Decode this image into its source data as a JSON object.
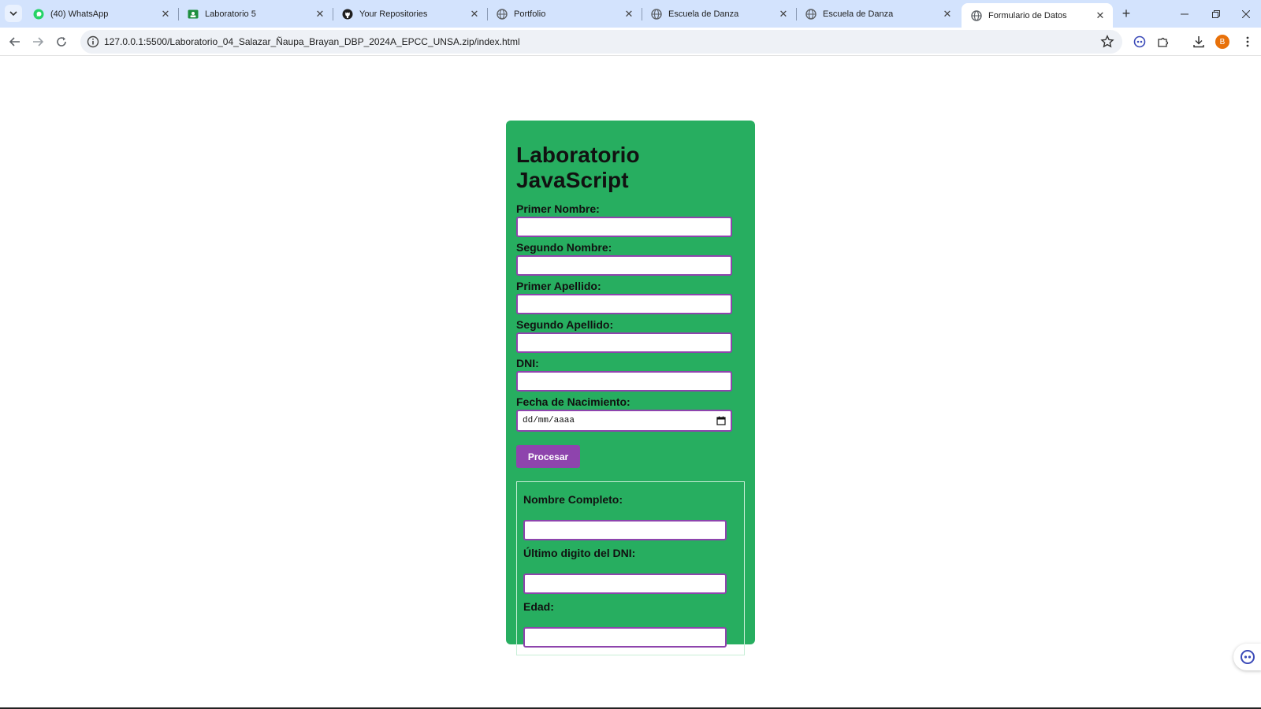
{
  "browser": {
    "tabs": [
      {
        "title": "(40) WhatsApp",
        "icon": "whatsapp-icon",
        "active": false
      },
      {
        "title": "Laboratorio 5",
        "icon": "classroom-icon",
        "active": false
      },
      {
        "title": "Your Repositories",
        "icon": "github-icon",
        "active": false
      },
      {
        "title": "Portfolio",
        "icon": "globe-icon",
        "active": false
      },
      {
        "title": "Escuela de Danza",
        "icon": "globe-icon",
        "active": false
      },
      {
        "title": "Escuela de Danza",
        "icon": "globe-icon",
        "active": false
      },
      {
        "title": "Formulario de Datos",
        "icon": "globe-icon",
        "active": true
      }
    ],
    "address": "127.0.0.1:5500/Laboratorio_04_Salazar_Ñaupa_Brayan_DBP_2024A_EPCC_UNSA.zip/index.html",
    "profile_initial": "B",
    "colors": {
      "tabstrip": "#d3e3fd",
      "profile": "#e8710a"
    }
  },
  "form": {
    "title": "Laboratorio JavaScript",
    "fields": [
      {
        "label": "Primer Nombre:",
        "value": ""
      },
      {
        "label": "Segundo Nombre:",
        "value": ""
      },
      {
        "label": "Primer Apellido:",
        "value": ""
      },
      {
        "label": "Segundo Apellido:",
        "value": ""
      },
      {
        "label": "DNI:",
        "value": ""
      }
    ],
    "birthdate": {
      "label": "Fecha de Nacimiento:",
      "placeholder": "dd/mm/aaaa"
    },
    "submit_label": "Procesar",
    "results": [
      {
        "label": "Nombre Completo:",
        "value": ""
      },
      {
        "label": "Último digito del DNI:",
        "value": ""
      },
      {
        "label": "Edad:",
        "value": ""
      }
    ],
    "colors": {
      "card": "#27ae60",
      "accent": "#8e44ad"
    }
  }
}
